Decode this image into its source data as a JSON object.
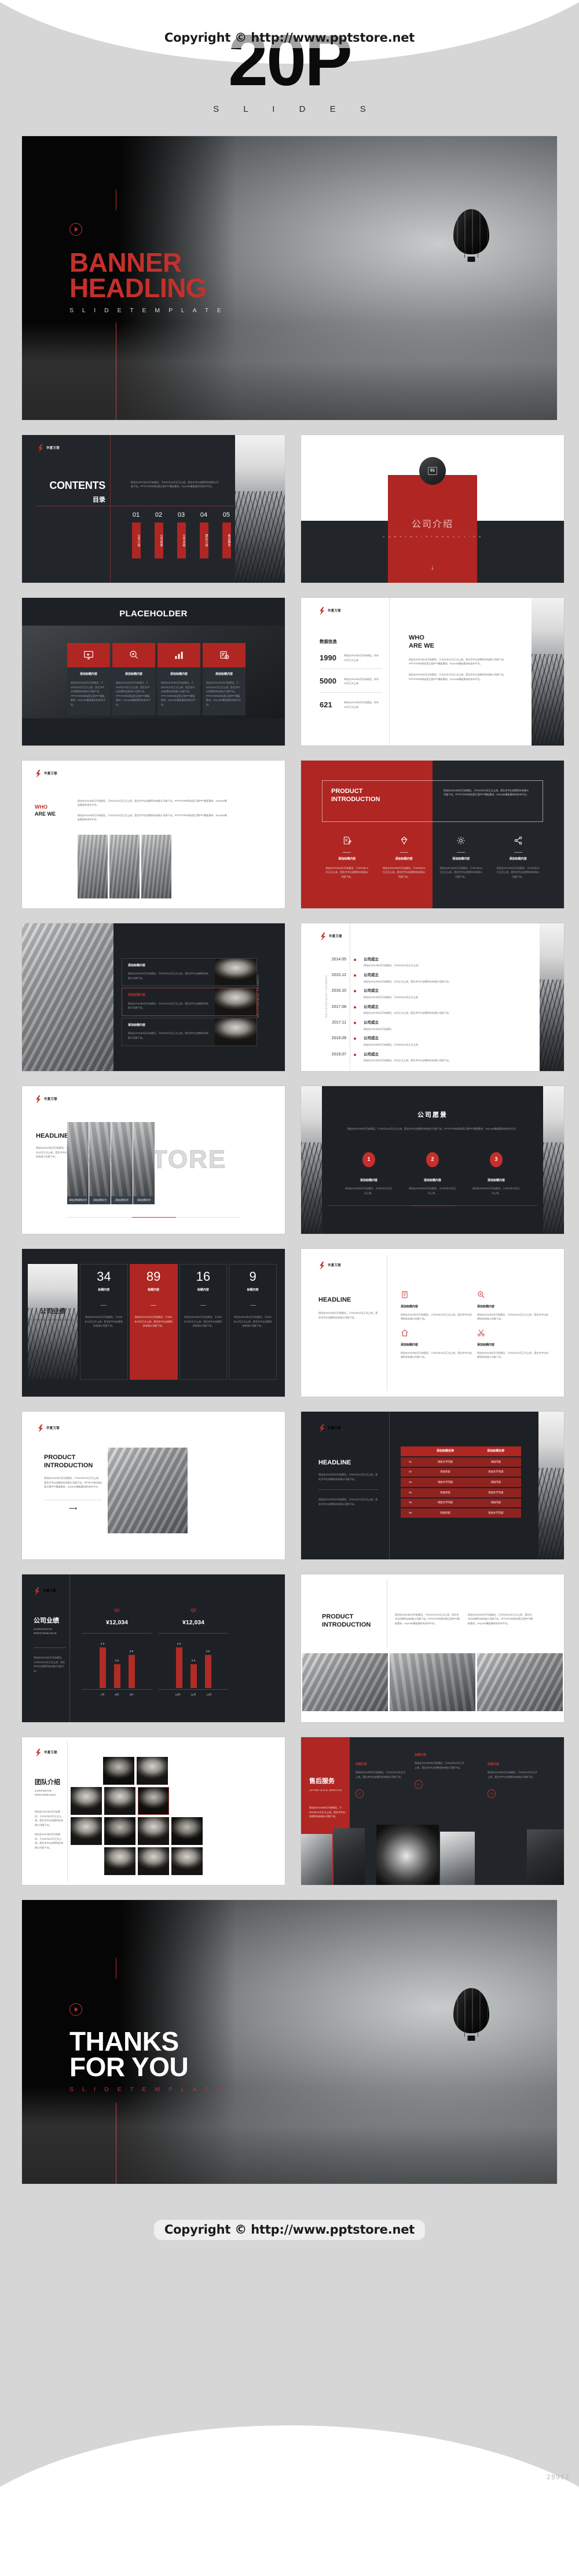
{
  "page": {
    "copyright_top": "Copyright © http://www.pptstore.net",
    "copyright_bottom": "Copyright © http://www.pptstore.net",
    "slide_count": "20P",
    "slides_word": "S L I D E S",
    "item_number": "28962",
    "accent_red": "#af2623",
    "dark_bg": "#22262b"
  },
  "brand": {
    "logo_text": "华夏万联",
    "logo_icon": "lightning-bolt-icon"
  },
  "banner": {
    "play_icon": "play-circle-icon",
    "title_line1": "BANNER",
    "title_line2": "HEADLING",
    "subtitle": "S L I D E   T E M P L A T E"
  },
  "thanks": {
    "play_icon": "play-circle-icon",
    "title_line1": "THANKS",
    "title_line2": "FOR YOU",
    "subtitle": "S L I D E   T E M P L A T E"
  },
  "body_cn": "网站在2011年8月开始建设，于2011年12月正式上线，是北京中幻创想科技有限公司旗下站，PPTSTORE网站是正版PPT模板素材，Keynote模板素材的发布平台。",
  "body_cn_short": "网站在2011年8月开始建设，于2011年12月正式上线，是北京中幻创想科技有限公司旗下站。",
  "body_cn_tiny": "网站在2011年8月开始建设，同年12月正式上线",
  "slides": [
    {
      "id": "contents",
      "title_en": "CONTENTS",
      "title_cn": "目录",
      "numbers": [
        "01",
        "02",
        "03",
        "04",
        "05"
      ],
      "items": [
        "公司介绍",
        "公司愿景",
        "公司业绩",
        "团队介绍",
        "售后服务"
      ]
    },
    {
      "id": "section-company-intro",
      "badge": "01",
      "title_cn": "公司介绍",
      "title_en": "C O M P A N Y   I N T R O D U C T I O N",
      "arrow_icon": "arrow-down-icon"
    },
    {
      "id": "placeholder-cards",
      "title": "PLACEHOLDER",
      "cards": [
        {
          "icon": "monitor-heart-icon",
          "title": "添加标题内容"
        },
        {
          "icon": "search-plus-icon",
          "title": "添加标题内容"
        },
        {
          "icon": "bar-chart-icon",
          "title": "添加标题内容"
        },
        {
          "icon": "calendar-clock-icon",
          "title": "添加标题内容"
        }
      ]
    },
    {
      "id": "who-are-we-stats",
      "stats_title": "数据信息",
      "stats": [
        {
          "value": "1990",
          "desc": "网站在2011年8月开始建设，同年12月正式上线"
        },
        {
          "value": "5000",
          "desc": "网站在2011年8月开始建设，同年12月正式上线"
        },
        {
          "value": "621",
          "desc": "网站在2011年8月开始建设，同年12月正式上线"
        }
      ],
      "heading_line1": "WHO",
      "heading_line2": "ARE WE"
    },
    {
      "id": "who-are-we-city",
      "heading_line1": "WHO",
      "heading_line2": "ARE WE"
    },
    {
      "id": "product-introduction-split",
      "title_line1": "PRODUCT",
      "title_line2": "INTRODUCTION",
      "features": [
        {
          "icon": "edit-note-icon",
          "title": "添加标题内容"
        },
        {
          "icon": "diamond-icon",
          "title": "添加标题内容"
        },
        {
          "icon": "gear-icon",
          "title": "添加标题内容"
        },
        {
          "icon": "share-icon",
          "title": "添加标题内容"
        }
      ]
    },
    {
      "id": "photo-list",
      "side_label": "COMPANY INTRODUCTION",
      "rows": [
        {
          "title": "添加标题内容",
          "active": false
        },
        {
          "title": "添加标题内容",
          "active": true
        },
        {
          "title": "添加标题内容",
          "active": false
        }
      ]
    },
    {
      "id": "timeline",
      "side_label": "COMPANY INTRODUCTION",
      "events": [
        {
          "date": "2014.05",
          "title": "公司成立",
          "desc": "网站在2011年8月开始建设，于2011年12月正式上线。"
        },
        {
          "date": "2015.12",
          "title": "公司成立",
          "desc": "网站在2011年8月开始建设，12月正式上线，是北京中幻创想科技有限公司旗下站。"
        },
        {
          "date": "2016.10",
          "title": "公司成立",
          "desc": "网站在2011年8月开始建设，于2011年12月正式上线"
        },
        {
          "date": "2017.08",
          "title": "公司成立",
          "desc": "网站在2011年8月开始建设，12月正式上线，是北京中幻创想科技有限公司旗下站。"
        },
        {
          "date": "2017.11",
          "title": "公司成立",
          "desc": "网站在2011年8月开始建设"
        },
        {
          "date": "2018.09",
          "title": "公司成立",
          "desc": "网站在2011年8月开始建设，于2011年12月正式上线"
        },
        {
          "date": "2019.07",
          "title": "公司成立",
          "desc": "网站在2011年8月开始建设，12月正式上线，是北京中幻创想科技有限公司旗下站。"
        }
      ]
    },
    {
      "id": "headline-gallery",
      "title": "HEADLINE",
      "captions": [
        "添加注释说明文字",
        "添加注释文字",
        "添加注释文字",
        "添加注释文字"
      ]
    },
    {
      "id": "company-vision",
      "title": "公司愿景",
      "steps": [
        {
          "num": "1",
          "title": "添加标题内容",
          "desc": "网站在2011年8月开始建设，于2011年12月正式上线。"
        },
        {
          "num": "2",
          "title": "添加标题内容",
          "desc": "网站在2011年8月开始建设，于2011年12月正式上线。"
        },
        {
          "num": "3",
          "title": "添加标题内容",
          "desc": "网站在2011年8月开始建设，于2011年12月正式上线。"
        }
      ]
    },
    {
      "id": "corporate-performance-kpi",
      "title_cn": "公司业绩",
      "title_en": "CORPORATE PERFORMANCE",
      "kpis": [
        {
          "value": "34",
          "label": "标题内容",
          "highlight": false
        },
        {
          "value": "89",
          "label": "标题内容",
          "highlight": true
        },
        {
          "value": "16",
          "label": "标题内容",
          "highlight": false
        },
        {
          "value": "9",
          "label": "标题内容",
          "highlight": false
        }
      ]
    },
    {
      "id": "headline-four-icons",
      "title": "HEADLINE",
      "features": [
        {
          "icon": "clipboard-icon",
          "title": "添加标题内容"
        },
        {
          "icon": "search-plus-icon",
          "title": "添加标题内容"
        },
        {
          "icon": "home-icon",
          "title": "添加标题内容"
        },
        {
          "icon": "scissors-icon",
          "title": "添加标题内容"
        }
      ]
    },
    {
      "id": "product-introduction-photo",
      "title_line1": "PRODUCT",
      "title_line2": "INTRODUCTION",
      "arrow_icon": "arrow-right-icon"
    },
    {
      "id": "headline-table",
      "title": "HEADLINE",
      "table": {
        "headers": [
          "",
          "添加标题名称",
          "添加标题名称"
        ],
        "rows": [
          [
            "01",
            "添加文字内容",
            "添加内容"
          ],
          [
            "02",
            "添加内容",
            "添加文字内容"
          ],
          [
            "03",
            "添加文字内容",
            "添加内容"
          ],
          [
            "04",
            "添加内容",
            "添加文字内容"
          ],
          [
            "05",
            "添加文字内容",
            "添加内容"
          ],
          [
            "06",
            "添加内容",
            "添加文字内容"
          ]
        ]
      }
    },
    {
      "id": "corporate-performance-chart",
      "title_cn": "公司业绩",
      "title_en": "CORPORATE PERFORMANCE"
    },
    {
      "id": "product-introduction-three-photos",
      "title_line1": "PRODUCT",
      "title_line2": "INTRODUCTION"
    },
    {
      "id": "team-introduction",
      "title_cn": "团队介绍",
      "title_en": "CORPORATE PERFORMANCE"
    },
    {
      "id": "after-sale-service",
      "title_cn": "售后服务",
      "title_en": "AFTER-SALE SERVICE",
      "points": [
        {
          "num": "01",
          "title": "标题内容",
          "desc": "网站在2011年8月开始建设，于2011年12月正式上线，是北京中幻创想科技有限公司旗下站。"
        },
        {
          "num": "02",
          "title": "标题内容",
          "desc": "网站在2011年8月开始建设，于2011年12月正式上线，是北京中幻创想科技有限公司旗下站。"
        },
        {
          "num": "03",
          "title": "标题内容",
          "desc": "网站在2011年8月开始建设，于2011年12月正式上线，是北京中幻创想科技有限公司旗下站。"
        }
      ]
    }
  ],
  "chart_data": {
    "type": "bar",
    "title": "公司业绩",
    "subtitle": "CORPORATE PERFORMANCE",
    "groups": [
      {
        "name": "Q1",
        "total": "¥12,034",
        "categories": [
          "7月",
          "8月",
          "9月"
        ],
        "values": [
          4.3,
          2.5,
          3.5
        ]
      },
      {
        "name": "Q2",
        "total": "¥12,034",
        "categories": [
          "10月",
          "11月",
          "12月"
        ],
        "values": [
          4.3,
          2.5,
          3.5
        ]
      }
    ],
    "ylim": [
      0,
      5
    ],
    "grid": false,
    "legend": "none",
    "series_color": "#b32b25"
  }
}
